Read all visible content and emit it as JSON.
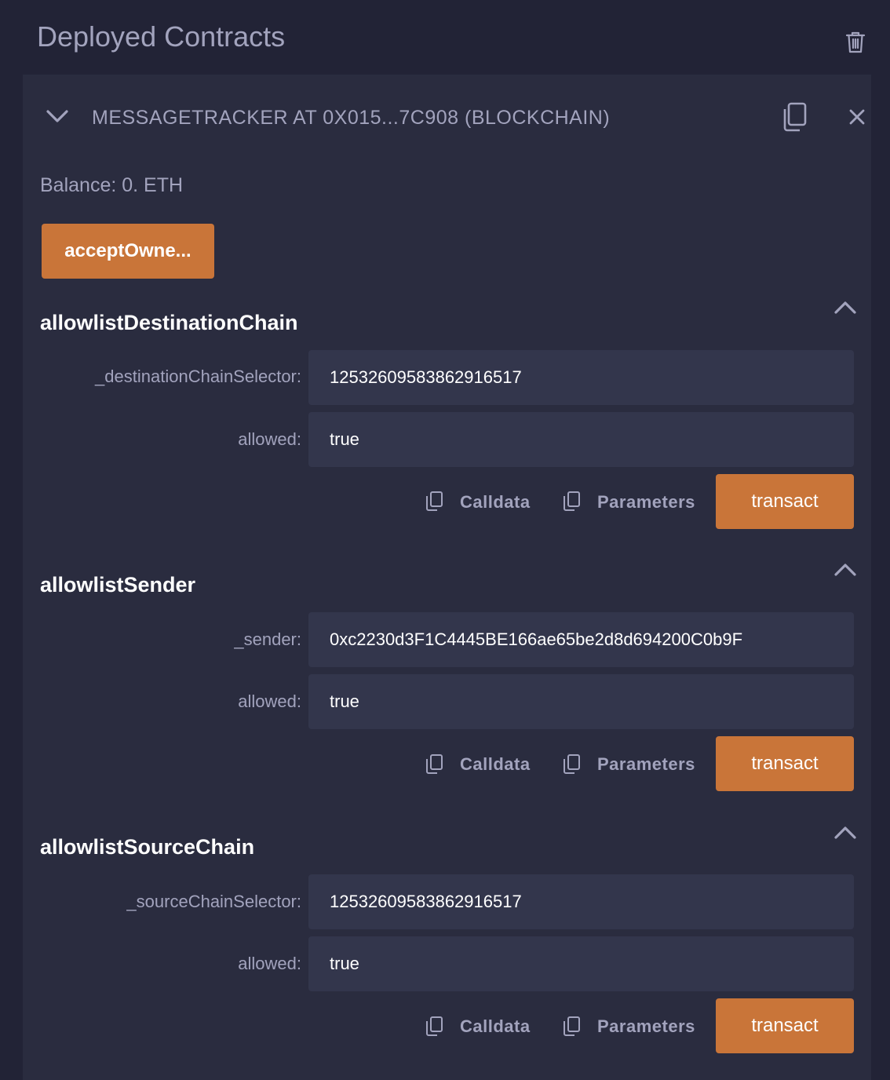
{
  "header": {
    "title": "Deployed Contracts",
    "trash_icon": "trash-icon"
  },
  "contract": {
    "title": "MESSAGETRACKER AT 0X015...7C908 (BLOCKCHAIN)",
    "balance": "Balance: 0. ETH",
    "accept_button": "acceptOwne..."
  },
  "functions": [
    {
      "name": "allowlistDestinationChain",
      "params": [
        {
          "label": "_destinationChainSelector:",
          "value": "12532609583862916517"
        },
        {
          "label": "allowed:",
          "value": "true"
        }
      ],
      "calldata_label": "Calldata",
      "parameters_label": "Parameters",
      "transact_label": "transact"
    },
    {
      "name": "allowlistSender",
      "params": [
        {
          "label": "_sender:",
          "value": "0xc2230d3F1C4445BE166ae65be2d8d694200C0b9F"
        },
        {
          "label": "allowed:",
          "value": "true"
        }
      ],
      "calldata_label": "Calldata",
      "parameters_label": "Parameters",
      "transact_label": "transact"
    },
    {
      "name": "allowlistSourceChain",
      "params": [
        {
          "label": "_sourceChainSelector:",
          "value": "12532609583862916517"
        },
        {
          "label": "allowed:",
          "value": "true"
        }
      ],
      "calldata_label": "Calldata",
      "parameters_label": "Parameters",
      "transact_label": "transact"
    }
  ],
  "colors": {
    "background": "#222336",
    "panel": "#2a2c3f",
    "input": "#33364c",
    "accent": "#c97539",
    "muted_text": "#a2a3bd"
  }
}
